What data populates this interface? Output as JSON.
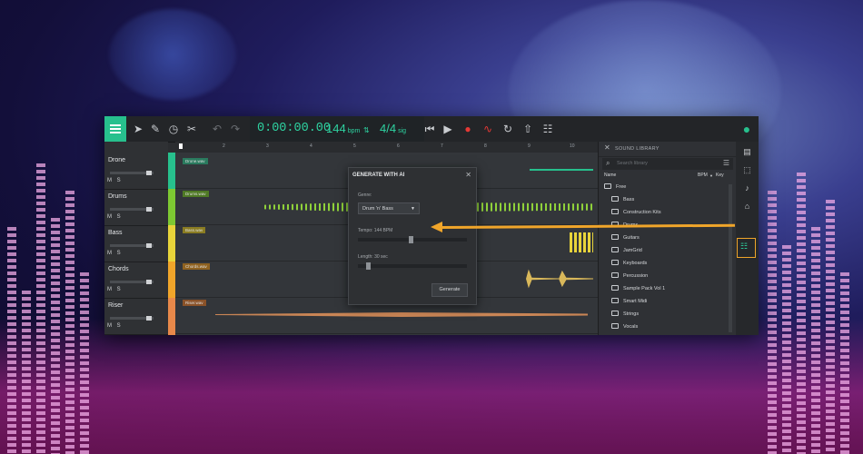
{
  "toolbar": {
    "time": "0:00:00.00",
    "bpm_value": "144",
    "bpm_unit": "bpm",
    "signature": "4/4",
    "sig_unit": "sig"
  },
  "tracks": [
    {
      "name": "Drone",
      "controls": "M S",
      "color": "#27c08d",
      "clip": "Drone.wav"
    },
    {
      "name": "Drums",
      "controls": "M S",
      "color": "#7ec832",
      "clip": "Drums.wav"
    },
    {
      "name": "Bass",
      "controls": "M S",
      "color": "#e8d43a",
      "clip": "Bass.wav"
    },
    {
      "name": "Chords",
      "controls": "M S",
      "color": "#f0a52a",
      "clip": "Chords.wav"
    },
    {
      "name": "Riser",
      "controls": "M S",
      "color": "#e8894a",
      "clip": "Riser.wav"
    }
  ],
  "ruler": [
    "2",
    "3",
    "4",
    "5",
    "6",
    "7",
    "8",
    "9",
    "10"
  ],
  "dialog": {
    "title": "GENERATE WITH AI",
    "genre_label": "Genre:",
    "genre_value": "Drum 'n' Bass",
    "tempo_label": "Tempo: 144 BPM",
    "tempo_fraction": 0.47,
    "length_label": "Length: 30 sec",
    "length_fraction": 0.08,
    "button": "Generate"
  },
  "library": {
    "title": "SOUND LIBRARY",
    "search_placeholder": "Search library",
    "col_name": "Name",
    "col_bpm": "BPM",
    "col_key": "Key",
    "root": "Free",
    "folders": [
      "Bass",
      "Construction Kits",
      "Drums",
      "Guitars",
      "JamGrid",
      "Keyboards",
      "Percussion",
      "Sample Pack Vol 1",
      "Smart Midi",
      "Strings",
      "Vocals"
    ]
  },
  "colors": {
    "accent": "#27c08d",
    "arrow": "#f0a52a"
  }
}
